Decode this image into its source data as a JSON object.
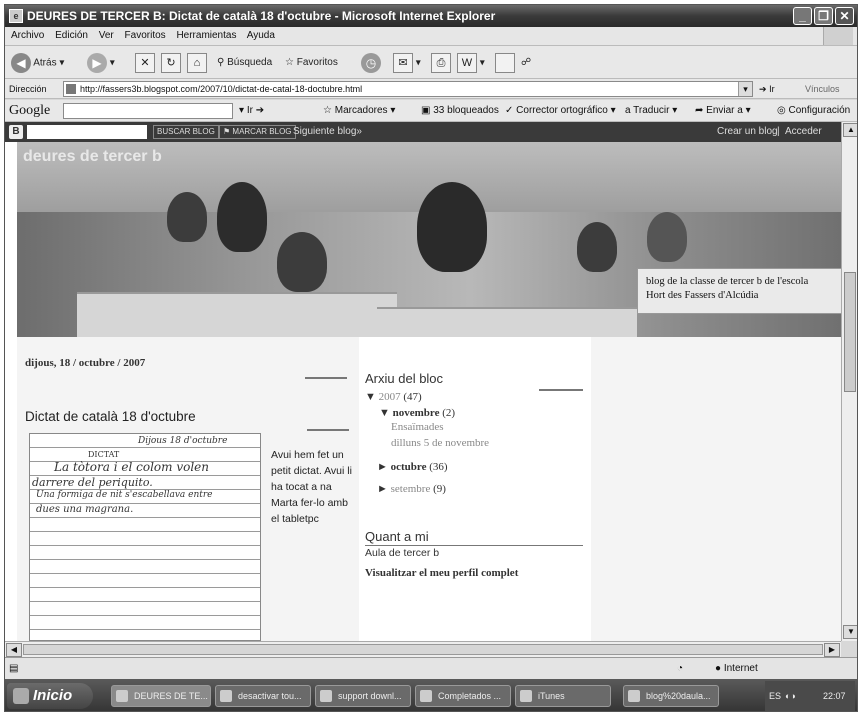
{
  "window": {
    "title": "DEURES DE TERCER B: Dictat de català 18 d'octubre - Microsoft Internet Explorer",
    "menu": [
      "Archivo",
      "Edición",
      "Ver",
      "Favoritos",
      "Herramientas",
      "Ayuda"
    ]
  },
  "toolbar": {
    "back": "Atrás",
    "search": "Búsqueda",
    "favorites": "Favoritos"
  },
  "address": {
    "label": "Dirección",
    "url": "http://fassers3b.blogspot.com/2007/10/dictat-de-catal-18-doctubre.html",
    "go": "Ir",
    "links": "Vínculos"
  },
  "googlebar": {
    "brand": "Google",
    "go": "Ir",
    "bookmarks": "Marcadores",
    "blocked": "33 bloqueados",
    "spell": "Corrector ortográfico",
    "translate": "Traducir",
    "send": "Enviar a",
    "settings": "Configuración"
  },
  "blognav": {
    "search_btn": "BUSCAR BLOG",
    "flag_btn": "MARCAR BLOG",
    "next": "Siguiente blog»",
    "create": "Crear un blog",
    "login": "Acceder"
  },
  "blog": {
    "title": "deures de tercer b",
    "description_1": "blog de la classe de tercer b de l'escola",
    "description_2": "Hort des Fassers d'Alcúdia"
  },
  "post": {
    "date": "dijous, 18 / octubre / 2007",
    "title": "Dictat de català 18 d'octubre",
    "body": "Avui hem fet un petit dictat. Avui li ha tocat a na Marta fer-lo amb el tabletpc",
    "handwriting": {
      "date": "Dijous 18 d'octubre",
      "heading": "DICTAT",
      "line1": "La tòtora i el colom volen",
      "line2": "darrere del periquito.",
      "line3": "Una formiga de nit s'escabellava entre",
      "line4": "dues una magrana."
    }
  },
  "archive": {
    "heading": "Arxiu del bloc",
    "year": "2007",
    "year_count": "(47)",
    "months": [
      {
        "name": "novembre",
        "count": "(2)",
        "expanded": true
      },
      {
        "name": "octubre",
        "count": "(36)",
        "expanded": false
      },
      {
        "name": "setembre",
        "count": "(9)",
        "expanded": false
      }
    ],
    "posts": [
      "Ensaïmades",
      "dilluns 5 de novembre"
    ]
  },
  "about": {
    "heading": "Quant a mi",
    "name": "Aula de tercer b",
    "profile_link": "Visualitzar el meu perfil complet"
  },
  "status": {
    "zone": "Internet"
  },
  "taskbar": {
    "start": "Inicio",
    "tasks": [
      "DEURES DE TE...",
      "desactivar tou...",
      "support downl...",
      "Completados ...",
      "iTunes",
      "blog%20daula..."
    ],
    "lang": "ES",
    "clock": "22:07"
  }
}
